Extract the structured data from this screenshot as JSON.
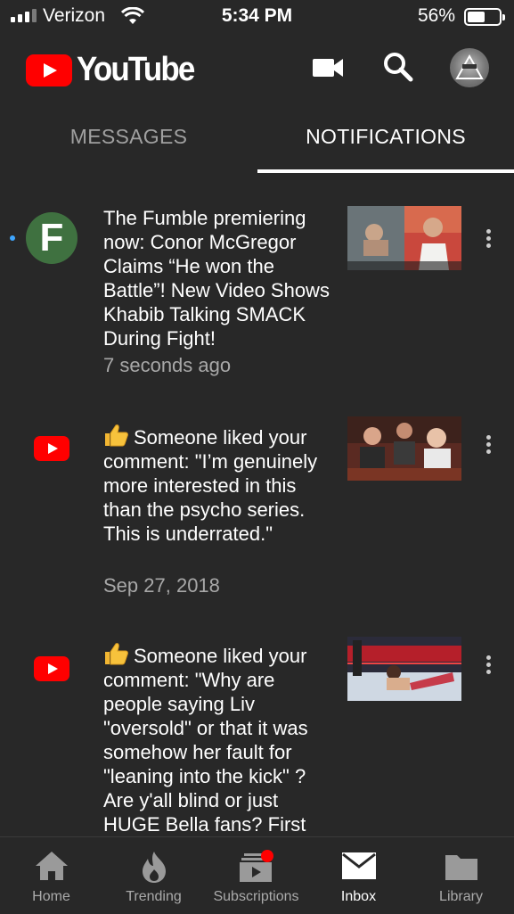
{
  "status_bar": {
    "carrier": "Verizon",
    "time": "5:34 PM",
    "battery_percent": "56%",
    "battery_level": 0.56
  },
  "header": {
    "logo_text": "YouTube",
    "icons": [
      "video-camera-icon",
      "search-icon",
      "account-avatar"
    ]
  },
  "tabs": [
    {
      "label": "MESSAGES",
      "active": false
    },
    {
      "label": "NOTIFICATIONS",
      "active": true
    }
  ],
  "notifications": [
    {
      "unread": true,
      "source": "The Fumble channel",
      "avatar_letter": "F",
      "text": "The Fumble premiering now: Conor McGregor Claims “He won the Battle”! New Video Shows Khabib Talking SMACK During Fight!",
      "time": "7 seconds ago"
    },
    {
      "unread": false,
      "source": "YouTube",
      "text": "Someone liked your comment: \"I’m genuinely more interested in this than the psycho series. This is underrated.\"",
      "time": "Sep 27, 2018"
    },
    {
      "unread": false,
      "source": "YouTube",
      "text": "Someone liked your comment: \"Why are people saying Liv \"oversold\" or that it was somehow her fault for \"leaning into the kick\" ? Are y'all blind or just HUGE Bella fans? First",
      "time": ""
    }
  ],
  "bottom_nav": [
    {
      "label": "Home",
      "icon": "home-icon",
      "active": false
    },
    {
      "label": "Trending",
      "icon": "trending-flame-icon",
      "active": false
    },
    {
      "label": "Subscriptions",
      "icon": "subscriptions-icon",
      "active": false
    },
    {
      "label": "Inbox",
      "icon": "inbox-mail-icon",
      "active": true
    },
    {
      "label": "Library",
      "icon": "library-folder-icon",
      "active": false
    }
  ],
  "colors": {
    "background": "#282828",
    "brand_red": "#ff0000",
    "unread_dot": "#3ea6ff",
    "secondary_text": "#a8a8a8"
  }
}
